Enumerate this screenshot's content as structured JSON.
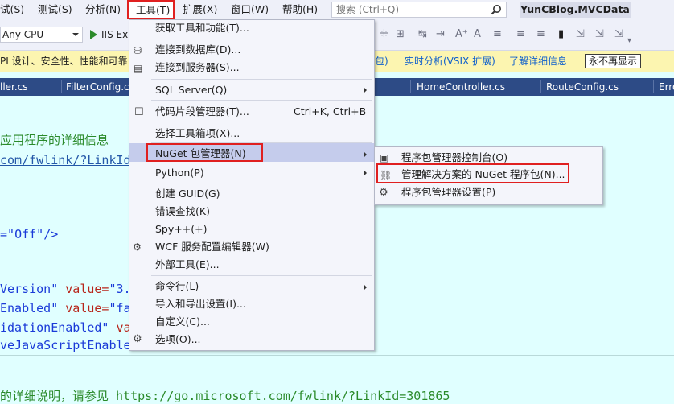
{
  "menubar": {
    "items": [
      "试(S)",
      "测试(S)",
      "分析(N)",
      "工具(T)",
      "扩展(X)",
      "窗口(W)",
      "帮助(H)"
    ],
    "search_placeholder": "搜索 (Ctrl+Q)",
    "project_title": "YunCBlog.MVCData"
  },
  "toolbar": {
    "platform": "Any CPU",
    "run_label": "IIS Ex"
  },
  "infobar": {
    "text1": "PI 设计、安全性、性能和可靠",
    "link1": "包)",
    "link2": "实时分析(VSIX 扩展)",
    "link3": "了解详细信息",
    "button": "永不再显示"
  },
  "tabs": [
    "ller.cs",
    "FilterConfig.c",
    "HomeController.cs",
    "RouteConfig.cs",
    "Erro"
  ],
  "editor": {
    "lines": {
      "l1": "应用程序的详细信息",
      "l2": "com/fwlink/?LinkId",
      "l3a": "=\"",
      "l3b": "Off\"",
      "l3c": "/>",
      "l4a": "Version\"",
      "l4b": " value=",
      "l4c": "\"3.",
      "l5a": "Enabled\"",
      "l5b": " value=",
      "l5c": "\"fa",
      "l6a": "idationEnabled\"",
      "l6b": " va",
      "l7": "veJavaScriptEnable",
      "l8": "的详细说明，请参见 https://go.microsoft.com/fwlink/?LinkId=301865"
    }
  },
  "tools_menu": {
    "get_tools": "获取工具和功能(T)...",
    "connect_db": "连接到数据库(D)...",
    "connect_server": "连接到服务器(S)...",
    "sql_server": "SQL Server(Q)",
    "snippets": "代码片段管理器(T)...",
    "snippets_shortcut": "Ctrl+K, Ctrl+B",
    "choose_toolbox": "选择工具箱项(X)...",
    "nuget": "NuGet 包管理器(N)",
    "python": "Python(P)",
    "create_guid": "创建 GUID(G)",
    "error_lookup": "错误查找(K)",
    "spy": "Spy++(+)",
    "wcf": "WCF 服务配置编辑器(W)",
    "external_tools": "外部工具(E)...",
    "command_line": "命令行(L)",
    "import_export": "导入和导出设置(I)...",
    "customize": "自定义(C)...",
    "options": "选项(O)..."
  },
  "nuget_submenu": {
    "console": "程序包管理器控制台(O)",
    "manage_solution": "管理解决方案的 NuGet 程序包(N)...",
    "settings": "程序包管理器设置(P)"
  },
  "colors": {
    "menu_bg": "#eef0f9",
    "tab_strip": "#2d4b86",
    "editor_bg": "#e0ffff",
    "highlight": "#c5ccec",
    "red_box": "#e02020"
  }
}
